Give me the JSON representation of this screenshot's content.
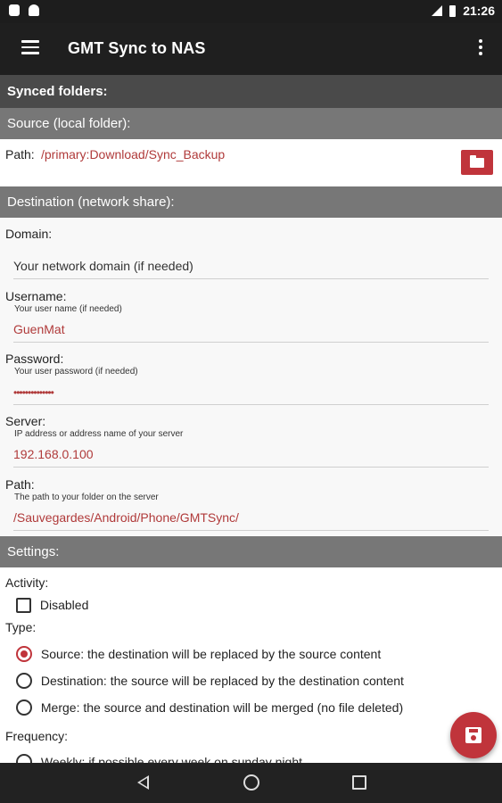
{
  "status_bar": {
    "time": "21:26"
  },
  "app_bar": {
    "title": "GMT Sync to NAS"
  },
  "synced_folders": {
    "header": "Synced folders:"
  },
  "source": {
    "header": "Source (local folder):",
    "path_label": "Path:",
    "path_value": "/primary:Download/Sync_Backup"
  },
  "destination": {
    "header": "Destination (network share):",
    "domain": {
      "label": "Domain:",
      "hint": "",
      "placeholder": "Your network domain (if needed)"
    },
    "username": {
      "label": "Username:",
      "hint": "Your user name (if needed)",
      "value": "GuenMat"
    },
    "password": {
      "label": "Password:",
      "hint": "Your user password (if needed)",
      "value": "••••••••••••••"
    },
    "server": {
      "label": "Server:",
      "hint": "IP address or address name of your server",
      "value": "192.168.0.100"
    },
    "path": {
      "label": "Path:",
      "hint": "The path to your folder on the server",
      "value": "/Sauvegardes/Android/Phone/GMTSync/"
    }
  },
  "settings": {
    "header": "Settings:",
    "activity_label": "Activity:",
    "disabled_label": "Disabled",
    "disabled_checked": false,
    "type_label": "Type:",
    "type_options": [
      {
        "label": "Source: the destination will be replaced by the source content",
        "selected": true
      },
      {
        "label": "Destination: the source will be replaced by the destination content",
        "selected": false
      },
      {
        "label": "Merge: the source and destination will be merged (no file deleted)",
        "selected": false
      }
    ],
    "frequency_label": "Frequency:",
    "frequency_options": [
      {
        "label": "Weekly: if possible every week on sunday night",
        "selected": false
      }
    ]
  },
  "icons": {
    "menu": "hamburger-menu-icon",
    "overflow": "more-vert-icon",
    "folder": "folder-icon",
    "save": "save-icon",
    "accent_color": "#c0343b"
  }
}
